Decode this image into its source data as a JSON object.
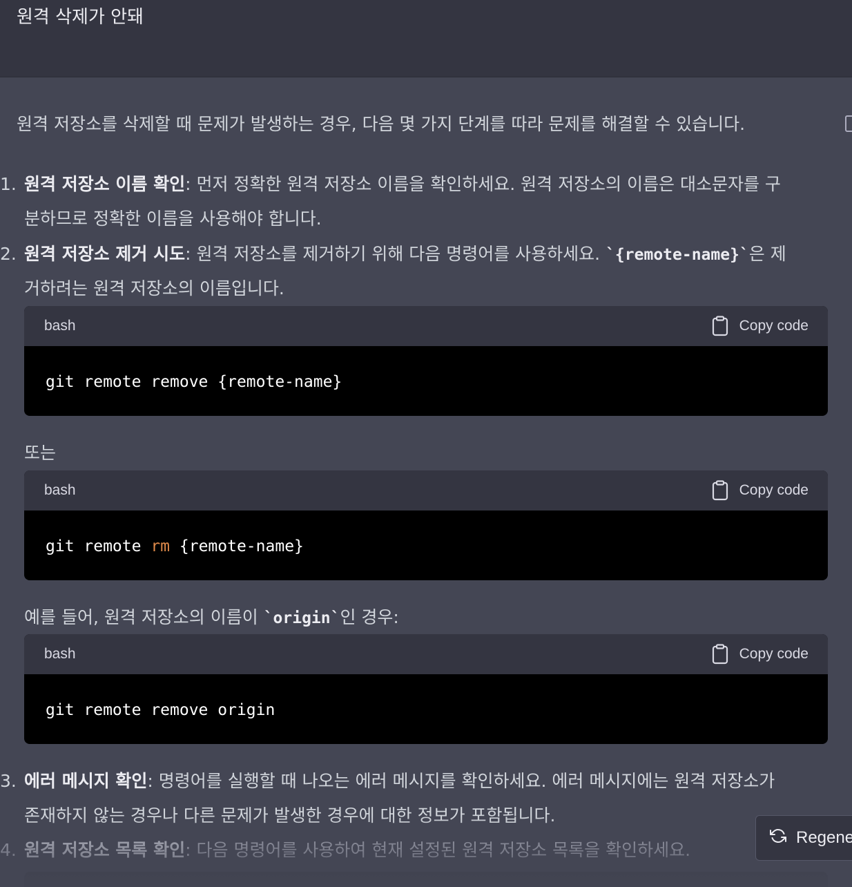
{
  "user_message": {
    "text": "원격 삭제가 안돼"
  },
  "response": {
    "intro": "원격 저장소를 삭제할 때 문제가 발생하는 경우, 다음 몇 가지 단계를 따라 문제를 해결할 수 있습니다.",
    "items": [
      {
        "number": "1.",
        "title": "원격 저장소 이름 확인",
        "line1": ": 먼저 정확한 원격 저장소 이름을 확인하세요. 원격 저장소의 이름은 대소문자를 구",
        "line2": "분하므로 정확한 이름을 사용해야 합니다."
      },
      {
        "number": "2.",
        "title": "원격 저장소 제거 시도",
        "line1_pre": ": 원격 저장소를 제거하기 위해 다음 명령어를 사용하세요. ",
        "line1_code": "`{remote-name}`",
        "line1_post": "은 제",
        "line2": "거하려는 원격 저장소의 이름입니다."
      },
      {
        "number": "3.",
        "title": "에러 메시지 확인",
        "line1": ": 명령어를 실행할 때 나오는 에러 메시지를 확인하세요. 에러 메시지에는 원격 저장소가",
        "line2": "존재하지 않는 경우나 다른 문제가 발생한 경우에 대한 정보가 포함됩니다."
      },
      {
        "number": "4.",
        "title": "원격 저장소 목록 확인",
        "line1": ": 다음 명령어를 사용하여 현재 설정된 원격 저장소 목록을 확인하세요."
      }
    ],
    "or_text": "또는",
    "example_pre": "예를 들어, 원격 저장소의 이름이 ",
    "example_code": "`origin`",
    "example_post": "인 경우:",
    "code_blocks": [
      {
        "lang": "bash",
        "copy_label": "Copy code",
        "code_a": "git remote remove {remote-name}"
      },
      {
        "lang": "bash",
        "copy_label": "Copy code",
        "code_a": "git remote ",
        "code_kw": "rm",
        "code_b": " {remote-name}"
      },
      {
        "lang": "bash",
        "copy_label": "Copy code",
        "code_a": "git remote remove origin"
      }
    ]
  },
  "regenerate": {
    "label": "Regenerate response"
  },
  "icons": {
    "copy": "clipboard-icon",
    "regenerate": "refresh-icon"
  }
}
